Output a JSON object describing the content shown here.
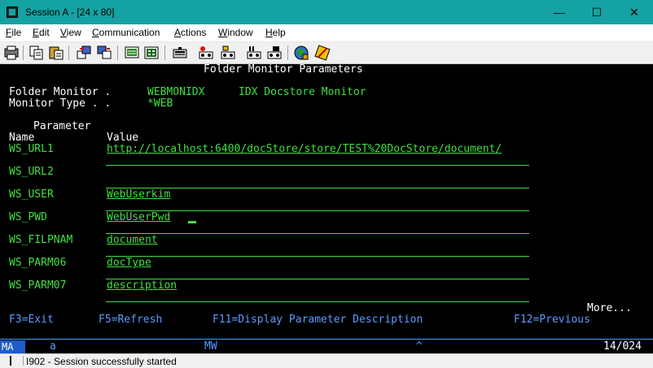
{
  "window": {
    "title": "Session A - [24 x 80]",
    "minimize": "—",
    "maximize": "☐",
    "close": "✕"
  },
  "menu": {
    "items": [
      {
        "label": "File",
        "key": "F"
      },
      {
        "label": "Edit",
        "key": "E"
      },
      {
        "label": "View",
        "key": "V"
      },
      {
        "label": "Communication",
        "key": "C"
      },
      {
        "label": "Actions",
        "key": "A"
      },
      {
        "label": "Window",
        "key": "W"
      },
      {
        "label": "Help",
        "key": "H"
      }
    ]
  },
  "toolbar": {
    "icons": [
      "print-screen-icon",
      "copy-icon",
      "paste-icon",
      "send-file-icon",
      "receive-file-icon",
      "display-icon",
      "keypad-icon",
      "macro-record-icon",
      "macro-play-icon",
      "macro-stop-icon",
      "macro-pause-icon",
      "play-icon",
      "keyboard-map-icon",
      "help-icon",
      "customize-icon"
    ]
  },
  "screen": {
    "header": "Folder Monitor Parameters",
    "folder_monitor_label": "Folder Monitor .",
    "folder_monitor_value": "WEBMONIDX",
    "folder_monitor_desc": "IDX Docstore Monitor",
    "monitor_type_label": "Monitor Type . .",
    "monitor_type_value": "*WEB",
    "col_parameter": "Parameter",
    "col_name": "Name",
    "col_value": "Value",
    "params": [
      {
        "name": "WS_URL1",
        "value": "http://localhost:6400/docStore/store/TEST%20DocStore/document/"
      },
      {
        "name": "WS_URL2",
        "value": ""
      },
      {
        "name": "WS_USER",
        "value": "WebUserkim"
      },
      {
        "name": "WS_PWD",
        "value": "WebUserPwd"
      },
      {
        "name": "WS_FILPNAM",
        "value": "document"
      },
      {
        "name": "WS_PARM06",
        "value": "docType"
      },
      {
        "name": "WS_PARM07",
        "value": "description"
      }
    ],
    "more": "More...",
    "fkeys": {
      "f3": "F3=Exit",
      "f5": "F5=Refresh",
      "f11": "F11=Display Parameter Description",
      "f12": "F12=Previous"
    }
  },
  "oia": {
    "ma": "MA",
    "a": "a",
    "mw": "MW",
    "caret": "^",
    "cursor_pos": "14/024"
  },
  "status": {
    "message": "I902 - Session successfully started"
  },
  "colors": {
    "titlebar": "#14a3a2",
    "terminal_bg": "#000000",
    "field_green": "#40e040",
    "header_white": "#ffffff",
    "fkey_blue": "#5b9bff"
  }
}
